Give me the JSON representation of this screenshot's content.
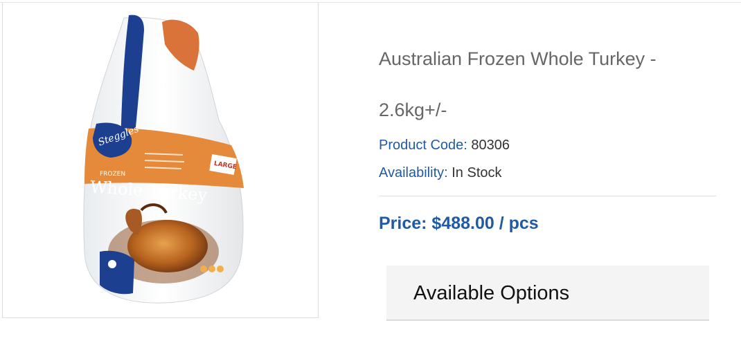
{
  "product": {
    "image_icon": "product-photo-frozen-whole-turkey",
    "package_brand": "Steggles",
    "package_frozen": "FROZEN",
    "package_name": "Whole Turkey",
    "package_size": "LARGE",
    "title_line1": "Australian Frozen Whole Turkey -",
    "title_line2": "2.6kg+/-",
    "code_label": "Product Code:",
    "code_value": "80306",
    "availability_label": "Availability:",
    "availability_value": "In Stock",
    "price": "Price: $488.00 / pcs"
  },
  "options": {
    "heading": "Available Options"
  },
  "colors": {
    "accent": "#1f5aa5",
    "title": "#666666",
    "package_orange": "#e58a3a",
    "package_blue": "#1c3f8f"
  }
}
